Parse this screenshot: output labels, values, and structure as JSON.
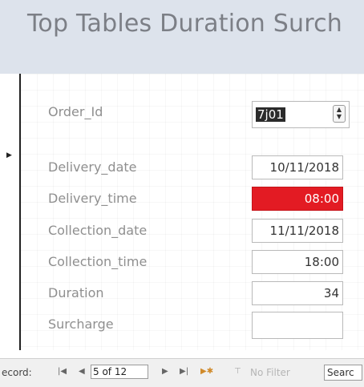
{
  "form": {
    "title": "Top Tables Duration Surch"
  },
  "fields": [
    {
      "label": "Order_Id",
      "value": "7j01",
      "highlight": "selected"
    },
    {
      "label": "Delivery_date",
      "value": "10/11/2018"
    },
    {
      "label": "Delivery_time",
      "value": "08:00",
      "background_color": "#e31b23",
      "text_color": "#ffffff"
    },
    {
      "label": "Collection_date",
      "value": "11/11/2018"
    },
    {
      "label": "Collection_time",
      "value": "18:00"
    },
    {
      "label": "Duration",
      "value": "34"
    },
    {
      "label": "Surcharge",
      "value": ""
    }
  ],
  "record_nav": {
    "label": "ecord:",
    "first_icon": "first-record-icon",
    "prev_icon": "previous-record-icon",
    "position": "5 of 12",
    "next_icon": "next-record-icon",
    "last_icon": "last-record-icon",
    "new_icon": "new-record-icon",
    "filter_icon": "filter-icon",
    "filter_text": "No Filter",
    "search_text": "Searc"
  },
  "colors": {
    "header_bg": "#dde3ec",
    "alert_red": "#e31b23"
  }
}
